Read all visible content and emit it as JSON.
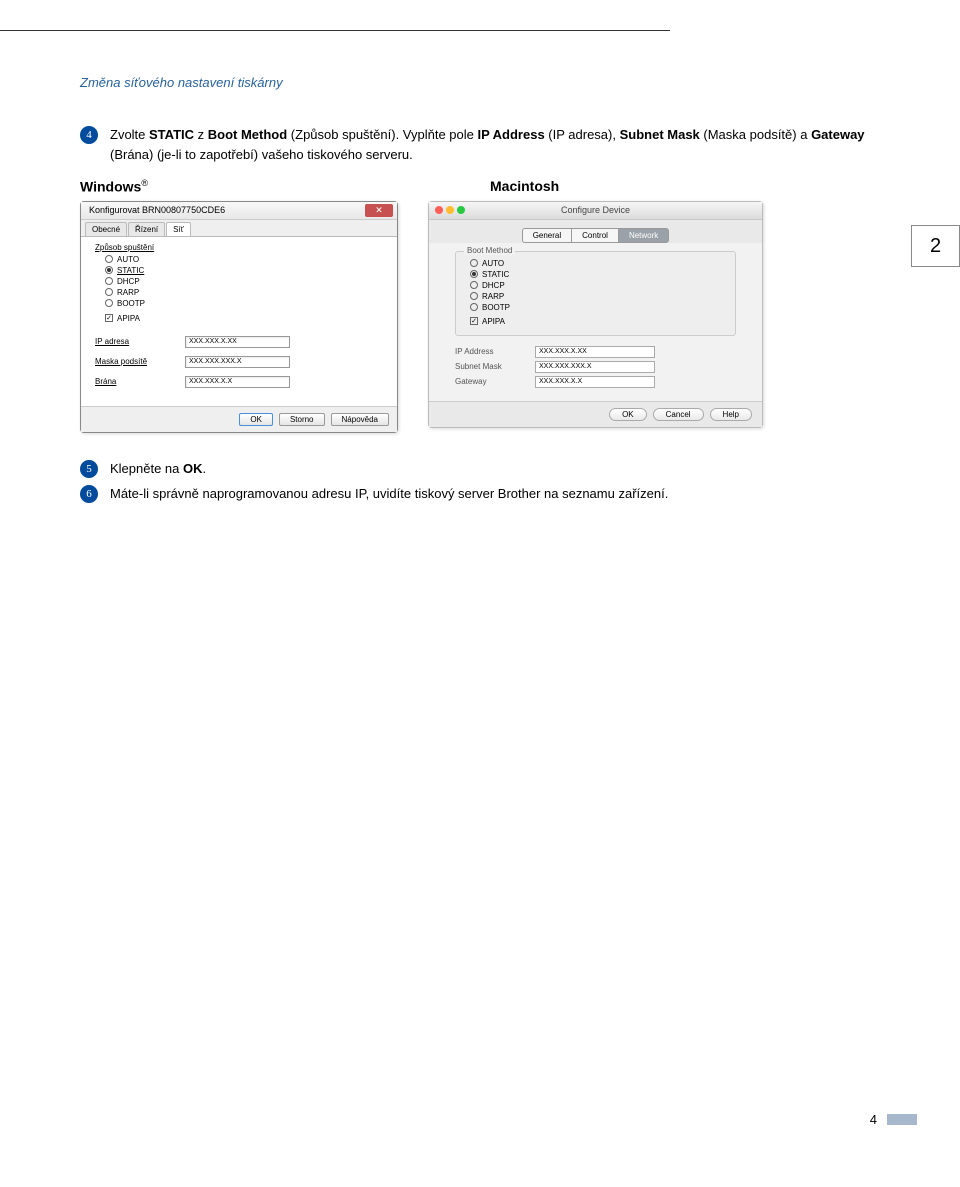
{
  "header": "Změna síťového nastavení tiskárny",
  "step4": {
    "num": "4",
    "parts": [
      "Zvolte ",
      "STATIC",
      " z ",
      "Boot Method",
      " (Způsob spuštění). Vyplňte pole ",
      "IP Address",
      " (IP adresa), ",
      "Subnet Mask",
      " (Maska podsítě) a ",
      "Gateway",
      " (Brána) (je-li to zapotřebí) vašeho tiskového serveru."
    ]
  },
  "os": {
    "windows": "Windows",
    "reg": "®",
    "mac": "Macintosh"
  },
  "win": {
    "title": "Konfigurovat BRN00807750CDE6",
    "tabs": [
      "Obecné",
      "Řízení",
      "Síť"
    ],
    "group_label": "Způsob spuštění",
    "options": [
      "AUTO",
      "STATIC",
      "DHCP",
      "RARP",
      "BOOTP"
    ],
    "apipa": "APIPA",
    "fields": {
      "ip_l": "IP adresa",
      "ip_v": "XXX.XXX.X.XX",
      "mask_l": "Maska podsítě",
      "mask_v": "XXX.XXX.XXX.X",
      "gw_l": "Brána",
      "gw_v": "XXX.XXX.X.X"
    },
    "buttons": {
      "ok": "OK",
      "cancel": "Storno",
      "help": "Nápověda"
    }
  },
  "mac": {
    "title": "Configure Device",
    "tabs": [
      "General",
      "Control",
      "Network"
    ],
    "group": "Boot Method",
    "options": [
      "AUTO",
      "STATIC",
      "DHCP",
      "RARP",
      "BOOTP"
    ],
    "apipa": "APIPA",
    "fields": {
      "ip_l": "IP Address",
      "ip_v": "XXX.XXX.X.XX",
      "mask_l": "Subnet Mask",
      "mask_v": "XXX.XXX.XXX.X",
      "gw_l": "Gateway",
      "gw_v": "XXX.XXX.X.X"
    },
    "buttons": {
      "ok": "OK",
      "cancel": "Cancel",
      "help": "Help"
    }
  },
  "step5": {
    "num": "5",
    "parts": [
      "Klepněte na ",
      "OK",
      "."
    ]
  },
  "step6": {
    "num": "6",
    "text": "Máte-li správně naprogramovanou adresu IP, uvidíte tiskový server Brother na seznamu zařízení."
  },
  "chapter": "2",
  "page": "4"
}
